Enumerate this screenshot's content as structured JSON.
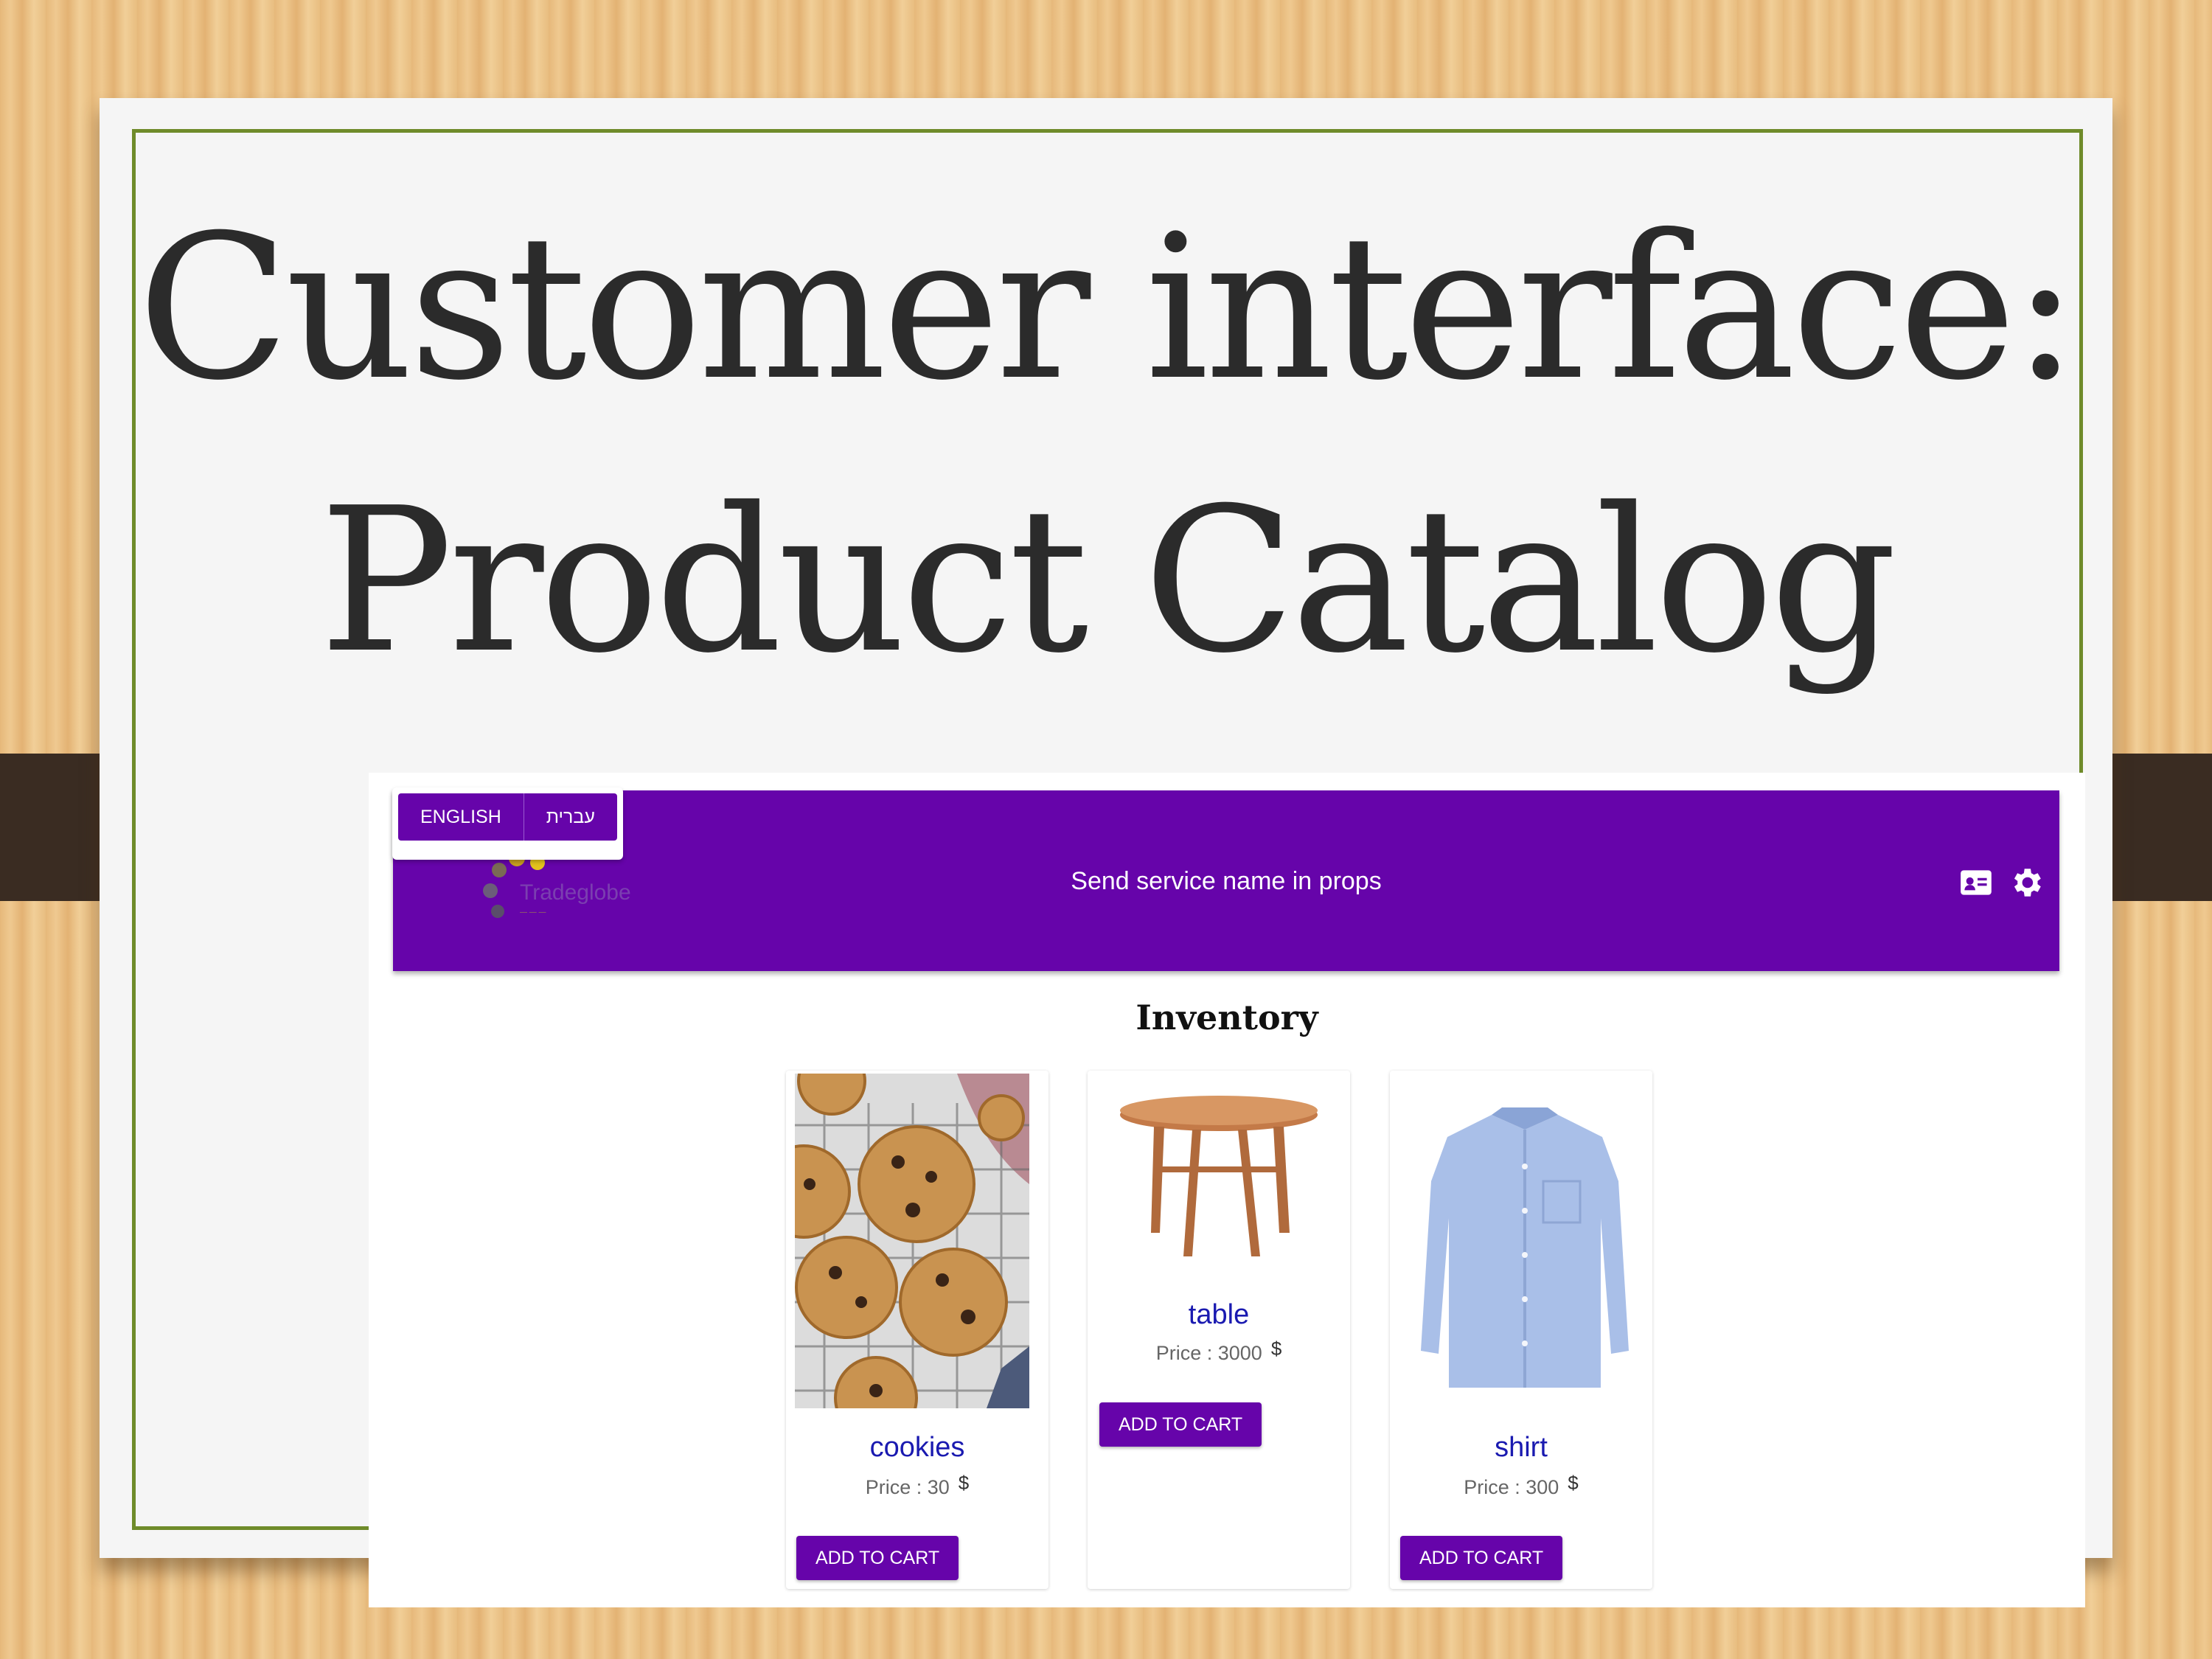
{
  "slide": {
    "title_line1": "Customer interface:",
    "title_line2": "Product Catalog"
  },
  "app": {
    "languages": [
      "ENGLISH",
      "עברית"
    ],
    "header_title": "Send service name in props",
    "icons": [
      "contact-card-icon",
      "gear-icon"
    ],
    "accent_color": "#6604aa"
  },
  "inventory": {
    "heading": "Inventory",
    "products": [
      {
        "name": "cookies",
        "price_label": "Price : 30",
        "currency": "$",
        "button": "ADD TO CART"
      },
      {
        "name": "table",
        "price_label": "Price : 3000",
        "currency": "$",
        "button": "ADD TO CART"
      },
      {
        "name": "shirt",
        "price_label": "Price : 300",
        "currency": "$",
        "button": "ADD TO CART"
      }
    ]
  }
}
